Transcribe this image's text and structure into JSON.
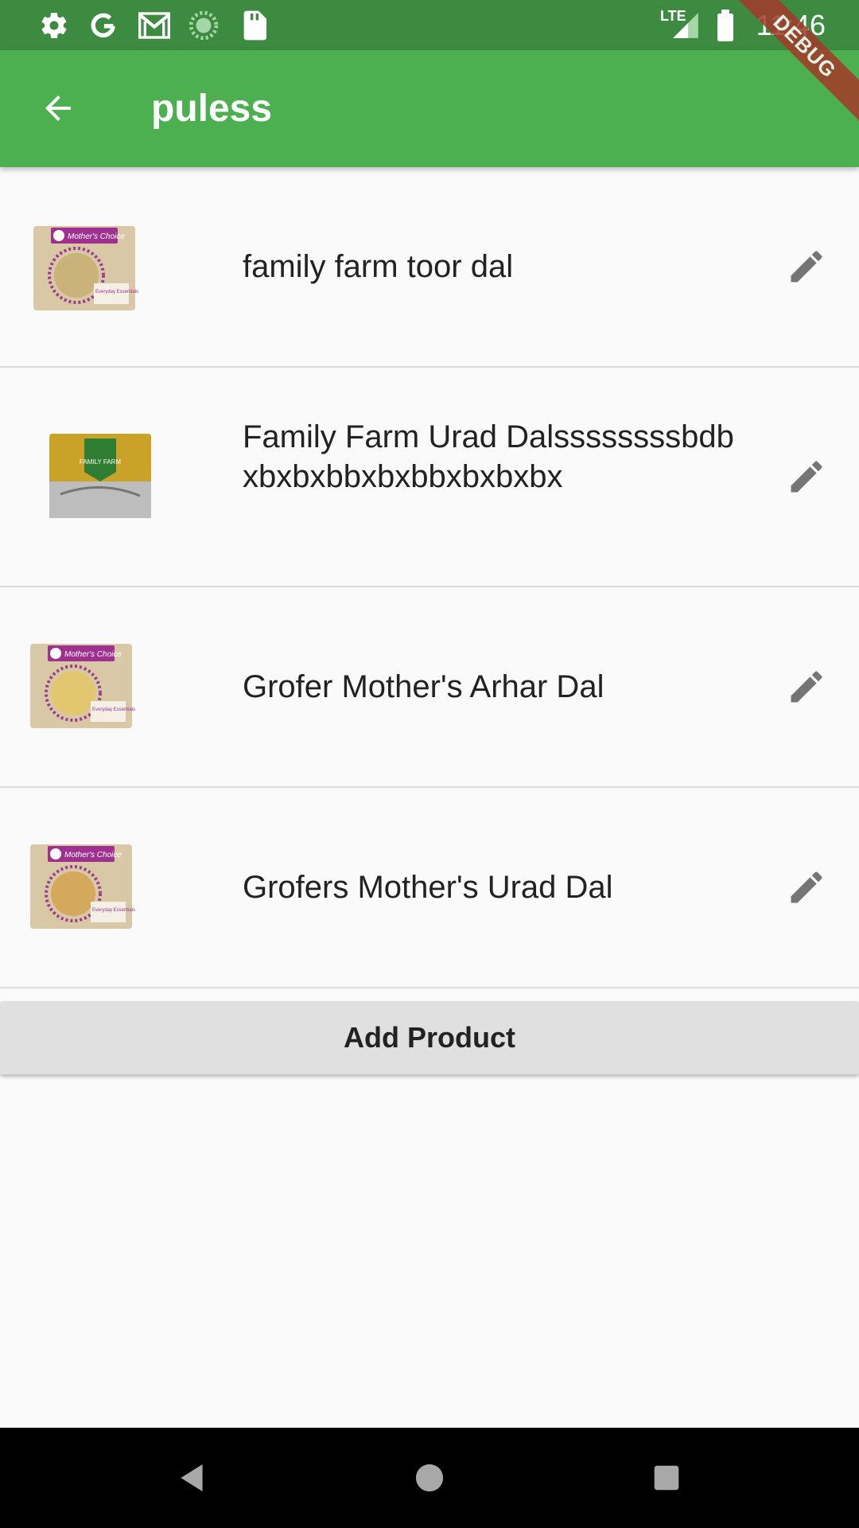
{
  "status_bar": {
    "time": "11:46",
    "network": "LTE",
    "icons": [
      "settings-icon",
      "google-icon",
      "gmail-icon",
      "loading-icon",
      "sd-card-icon",
      "signal-icon",
      "battery-icon"
    ]
  },
  "debug_banner": "DEBUG",
  "app_bar": {
    "title": "puless",
    "back_icon": "arrow-back-icon"
  },
  "products": [
    {
      "name": "family farm toor dal",
      "image": "mothers-choice-pack",
      "pack_brand": "Mother's Choice",
      "pack_label": "Everyday Essentials"
    },
    {
      "name": "Family Farm Urad Dalssssssssbdbxbxbxbbxbxbbxbxbxbx",
      "image": "family-farm-pack",
      "pack_brand": "FAMILY FARM",
      "pack_label": ""
    },
    {
      "name": "Grofer Mother's Arhar Dal",
      "image": "mothers-choice-pack",
      "pack_brand": "Mother's Choice",
      "pack_label": "Everyday Essentials"
    },
    {
      "name": "Grofers Mother's Urad Dal",
      "image": "mothers-choice-pack",
      "pack_brand": "Mother's Choice",
      "pack_label": "Everyday Essentials"
    }
  ],
  "add_button": {
    "label": "Add Product"
  },
  "colors": {
    "status_bar": "#3d8b40",
    "app_bar": "#4caf50",
    "background": "#fafafa",
    "button": "#e0e0e0",
    "edit_icon": "#757575"
  }
}
